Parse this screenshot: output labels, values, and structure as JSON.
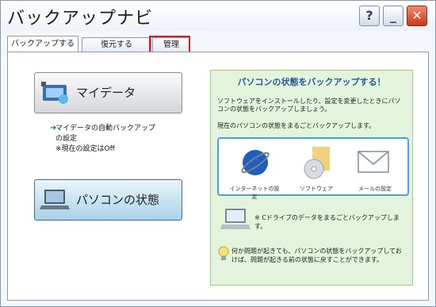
{
  "window": {
    "title": "バックアップナビ"
  },
  "titlebar": {
    "help": "?",
    "minimize": "_",
    "close": "✕"
  },
  "tabs": [
    {
      "label": "バックアップする",
      "active": true
    },
    {
      "label": "復元する",
      "active": false
    },
    {
      "label": "管理",
      "active": false,
      "highlighted": true
    }
  ],
  "left": {
    "mydata_button": "マイデータ",
    "link_text": "マイデータの自動バックアップの設定",
    "link_line1": "マイデータの自動バックアップ",
    "link_line2": "の設定",
    "status": "※現在の設定はOff",
    "pc_button": "パソコンの状態"
  },
  "right": {
    "heading": "パソコンの状態をバックアップする！",
    "desc": "ソフトウェアをインストールしたり、設定を変更したときにパソコンの状態をバックアップしましょう。",
    "desc2": "現在のパソコンの状態をまるごとバックアップします。",
    "items": [
      "インターネットの設定",
      "ソフトウェア",
      "メールの設定"
    ],
    "note_c": "※ Cドライブのデータをまるごとバックアップします。",
    "tip": "何か問題が起きても、パソコンの状態をバックアップしておけば、問題が起きる前の状態に戻すことができます。"
  },
  "colors": {
    "highlight": "#e01b1b",
    "accent": "#235d9a",
    "green_bg": "#e4f3db",
    "inner_border": "#48a3dc"
  }
}
